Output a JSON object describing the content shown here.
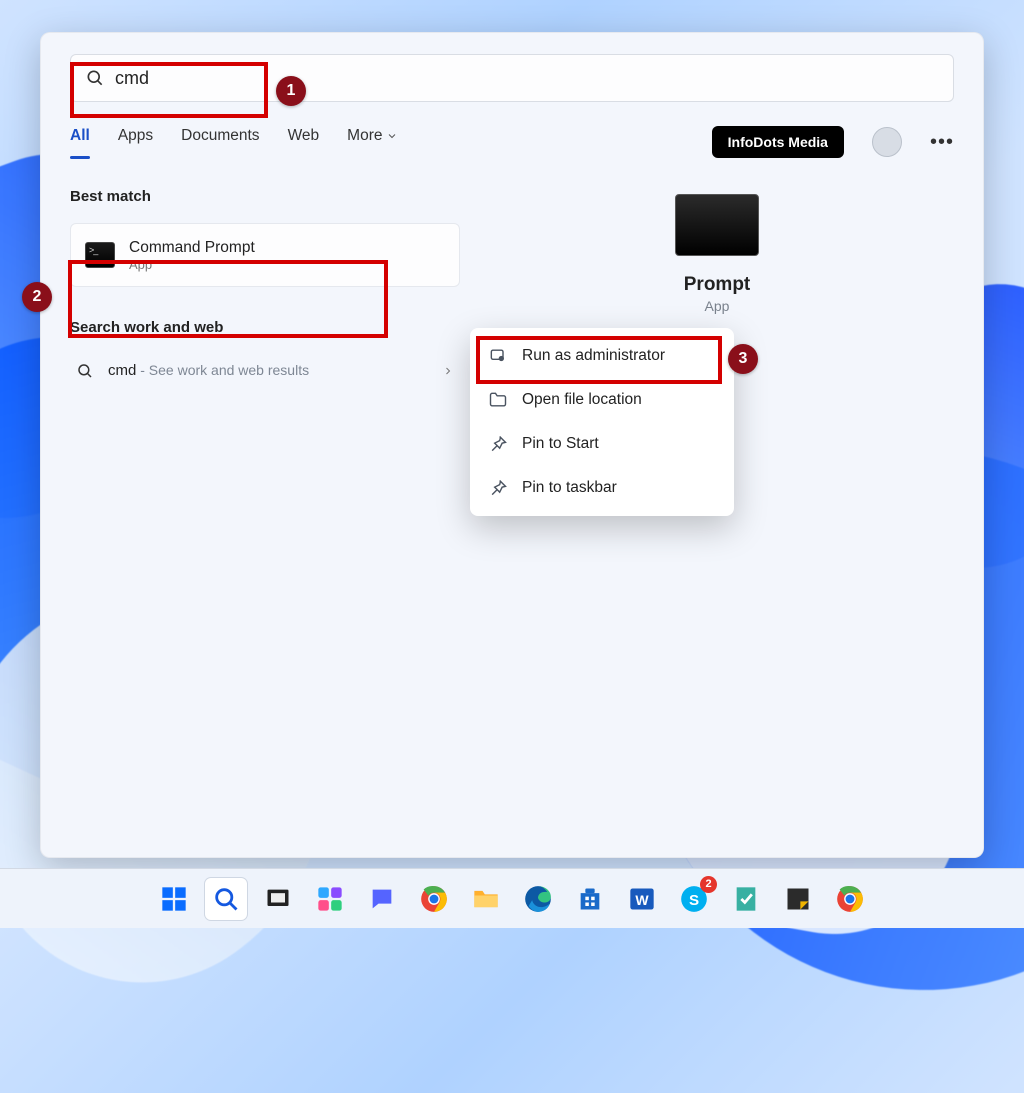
{
  "search": {
    "query": "cmd"
  },
  "tabs": {
    "t0": "All",
    "t1": "Apps",
    "t2": "Documents",
    "t3": "Web",
    "t4": "More"
  },
  "user": {
    "badge": "InfoDots Media"
  },
  "left": {
    "best_match_heading": "Best match",
    "result_title": "Command Prompt",
    "result_subtitle": "App",
    "search_web_heading": "Search work and web",
    "web_term": "cmd",
    "web_hint": " - See work and web results"
  },
  "preview": {
    "title_fragment": "Prompt",
    "subtitle_fragment": "App",
    "actions": {
      "a0": "Open file location",
      "a1": "Pin to Start",
      "a2": "Pin to taskbar"
    }
  },
  "ctx": {
    "i0": "Run as administrator",
    "i1": "Open file location",
    "i2": "Pin to Start",
    "i3": "Pin to taskbar"
  },
  "ann": {
    "n1": "1",
    "n2": "2",
    "n3": "3"
  },
  "taskbar": {
    "badge_count": "2"
  }
}
